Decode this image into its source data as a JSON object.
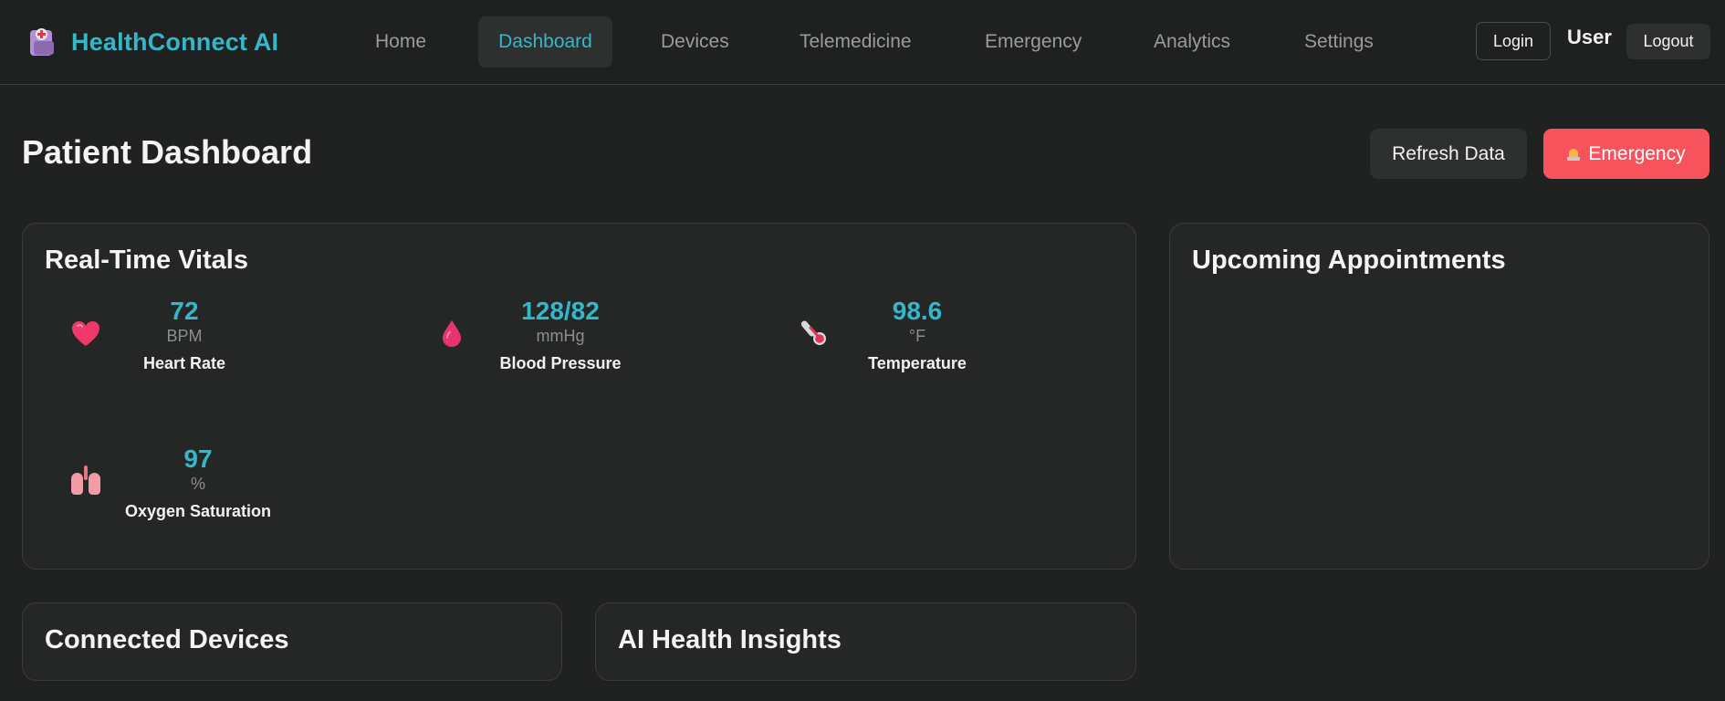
{
  "app": {
    "brand_name": "HealthConnect AI",
    "brand_icon": "hospital-icon"
  },
  "nav": {
    "items": [
      {
        "label": "Home",
        "active": false
      },
      {
        "label": "Dashboard",
        "active": true
      },
      {
        "label": "Devices",
        "active": false
      },
      {
        "label": "Telemedicine",
        "active": false
      },
      {
        "label": "Emergency",
        "active": false
      },
      {
        "label": "Analytics",
        "active": false
      },
      {
        "label": "Settings",
        "active": false
      }
    ]
  },
  "auth": {
    "login_label": "Login",
    "user_label": "User",
    "logout_label": "Logout"
  },
  "page": {
    "title": "Patient Dashboard",
    "refresh_label": "Refresh Data",
    "emergency_label": "Emergency",
    "emergency_icon": "siren-icon"
  },
  "vitals": {
    "title": "Real-Time Vitals",
    "items": [
      {
        "value": "72",
        "unit": "BPM",
        "label": "Heart Rate",
        "icon": "heart-icon"
      },
      {
        "value": "128/82",
        "unit": "mmHg",
        "label": "Blood Pressure",
        "icon": "blood-drop-icon"
      },
      {
        "value": "98.6",
        "unit": "°F",
        "label": "Temperature",
        "icon": "thermometer-icon"
      },
      {
        "value": "97",
        "unit": "%",
        "label": "Oxygen Saturation",
        "icon": "lungs-icon"
      }
    ]
  },
  "appointments": {
    "title": "Upcoming Appointments"
  },
  "devices": {
    "title": "Connected Devices"
  },
  "insights": {
    "title": "AI Health Insights"
  },
  "colors": {
    "accent": "#34b7c9",
    "emergency": "#f6535c",
    "background": "#202121",
    "card": "#252626"
  }
}
